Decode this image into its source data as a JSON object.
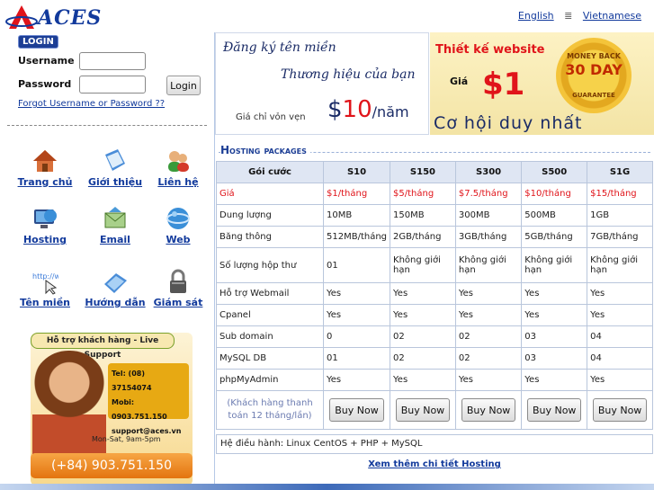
{
  "header": {
    "logo_text": "ACES",
    "lang_english": "English",
    "lang_sep": "≣",
    "lang_vietnamese": "Vietnamese"
  },
  "login": {
    "badge": "LOGIN",
    "username_label": "Username",
    "password_label": "Password",
    "button_label": "Login",
    "forgot_link": "Forgot Username or Password ??"
  },
  "nav": {
    "home": "Trang chủ",
    "about": "Giới thiệu",
    "contact": "Liên hệ",
    "hosting": "Hosting",
    "email": "Email",
    "web": "Web",
    "domain": "Tên miền",
    "guide": "Hướng dẫn",
    "monitor": "Giám sát"
  },
  "support": {
    "title": "Hỗ trợ khách hàng - Live Support",
    "tel": "Tel: (08) 37154074",
    "mobi": "Mobi: 0903.751.150",
    "email": "support@aces.vn",
    "hours": "Mon-Sat, 9am-5pm",
    "phone": "(+84) 903.751.150"
  },
  "banner_domain": {
    "line1": "Đăng ký tên miền",
    "line2": "Thương hiệu của bạn",
    "price_label": "Giá chỉ vỏn vẹn",
    "currency": "$",
    "amount": "10",
    "unit": "/năm"
  },
  "banner_web": {
    "title": "Thiết kế website",
    "price_label": "Giá",
    "price": "$1",
    "slogan": "Cơ hội duy nhất",
    "seal_top": "MONEY BACK",
    "seal_mid": "30 DAY",
    "seal_bottom": "GUARANTEE"
  },
  "hosting": {
    "title": "Hosting packages",
    "columns": [
      "Gói cước",
      "S10",
      "S150",
      "S300",
      "S500",
      "S1G"
    ],
    "rows": [
      {
        "label": "Giá",
        "values": [
          "$1/tháng",
          "$5/tháng",
          "$7.5/tháng",
          "$10/tháng",
          "$15/tháng"
        ]
      },
      {
        "label": "Dung lượng",
        "values": [
          "10MB",
          "150MB",
          "300MB",
          "500MB",
          "1GB"
        ]
      },
      {
        "label": "Băng thông",
        "values": [
          "512MB/tháng",
          "2GB/tháng",
          "3GB/tháng",
          "5GB/tháng",
          "7GB/tháng"
        ]
      },
      {
        "label": "Số lượng hộp thư",
        "values": [
          "01",
          "Không giới hạn",
          "Không giới hạn",
          "Không giới hạn",
          "Không giới hạn"
        ]
      },
      {
        "label": "Hỗ trợ Webmail",
        "values": [
          "Yes",
          "Yes",
          "Yes",
          "Yes",
          "Yes"
        ]
      },
      {
        "label": "Cpanel",
        "values": [
          "Yes",
          "Yes",
          "Yes",
          "Yes",
          "Yes"
        ]
      },
      {
        "label": "Sub domain",
        "values": [
          "0",
          "02",
          "02",
          "03",
          "04"
        ]
      },
      {
        "label": "MySQL DB",
        "values": [
          "01",
          "02",
          "02",
          "03",
          "04"
        ]
      },
      {
        "label": "phpMyAdmin",
        "values": [
          "Yes",
          "Yes",
          "Yes",
          "Yes",
          "Yes"
        ]
      }
    ],
    "note": "(Khách hàng thanh toán 12 tháng/lần)",
    "buy_label": "Buy Now",
    "os_text": "Hệ điều hành: Linux CentOS + PHP + MySQL",
    "more_link": "Xem thêm chi tiết Hosting"
  },
  "colors": {
    "brand_blue": "#123a9c",
    "price_red": "#e0141a",
    "support_orange": "#e3740f"
  }
}
